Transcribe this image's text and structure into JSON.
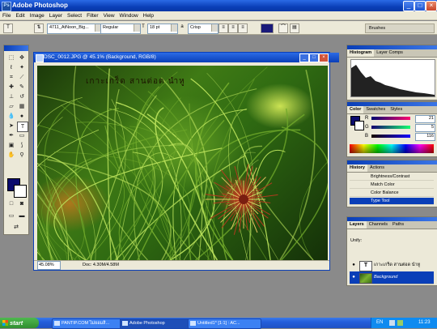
{
  "app": {
    "title": "Adobe Photoshop"
  },
  "menu": [
    "File",
    "Edit",
    "Image",
    "Layer",
    "Select",
    "Filter",
    "View",
    "Window",
    "Help"
  ],
  "options": {
    "tool_glyph": "T",
    "font_family": "4711_AtNoon_Big...",
    "font_style": "Regular",
    "font_size": "18 pt",
    "anti_alias": "Crisp",
    "text_color": "#1a1a7a",
    "palette_tab": "Brushes"
  },
  "document": {
    "title": "DSC_0012.JPG @ 45.1% (Background, RGB/8)",
    "zoom": "45.08%",
    "doc_size": "Doc: 4.30M/4.58M",
    "overlay_text": "เกาะเกร็ด สานต่อด นำหู"
  },
  "histogram": {
    "tabs": [
      "Histogram",
      "Layer Comps"
    ]
  },
  "color": {
    "tabs": [
      "Color",
      "Swatches",
      "Styles"
    ],
    "rows": [
      {
        "label": "R",
        "value": "21"
      },
      {
        "label": "G",
        "value": "5"
      },
      {
        "label": "B",
        "value": "116"
      }
    ],
    "foreground": "#0b0b6e"
  },
  "history": {
    "tabs": [
      "History",
      "Actions"
    ],
    "items": [
      "Brightness/Contrast",
      "Match Color",
      "Color Balance",
      "Type Tool"
    ]
  },
  "layers": {
    "tabs": [
      "Layers",
      "Channels",
      "Paths"
    ],
    "lock_label": "Unify:",
    "list": [
      {
        "name": "เกาะเกร็ด สานต่อด นำหู",
        "kind": "text"
      },
      {
        "name": "Background",
        "kind": "image"
      }
    ]
  },
  "taskbar": {
    "start": "start",
    "tasks": [
      "PANTIP.COM ไม่ยอมสิ...",
      "Adobe Photoshop",
      "Untitled1* [1:1] : AC..."
    ],
    "lang": "EN",
    "time": "11:23"
  }
}
